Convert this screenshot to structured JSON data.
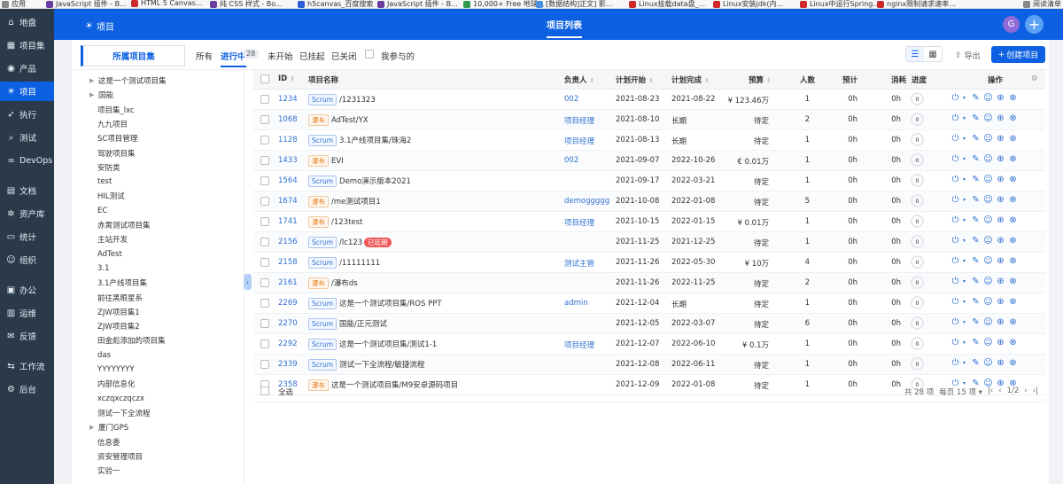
{
  "bookmarks": [
    {
      "label": "应用",
      "color": "#888888"
    },
    {
      "label": "JavaScript 插件 - B...",
      "color": "#6a3ea1"
    },
    {
      "label": "HTML 5 Canvas...",
      "color": "#cc2a2a"
    },
    {
      "label": "纯 CSS 样式 - Bo...",
      "color": "#6a3ea1"
    },
    {
      "label": "h5canvas_百度搜索",
      "color": "#2c5fd6"
    },
    {
      "label": "JavaScript 插件 - B...",
      "color": "#6a3ea1"
    },
    {
      "label": "10,000+ Free 地球...",
      "color": "#2e9b4c"
    },
    {
      "label": "[数据结构]正文] 影...",
      "color": "#4a90e2"
    },
    {
      "label": "Linux挂载data盘_...",
      "color": "#cc2a2a"
    },
    {
      "label": "Linux安装jdk(内...",
      "color": "#cc2a2a"
    },
    {
      "label": "Linux中运行Spring...",
      "color": "#cc2a2a"
    },
    {
      "label": "nginx限制请求速率...",
      "color": "#cc2a2a"
    },
    {
      "label": "阅读清单",
      "color": "#888888"
    }
  ],
  "sidebar": {
    "items": [
      {
        "label": "地盘",
        "icon": "home-icon",
        "glyph": "⌂",
        "active": false
      },
      {
        "label": "项目集",
        "icon": "grid-icon",
        "glyph": "▦",
        "active": false
      },
      {
        "label": "产品",
        "icon": "location-icon",
        "glyph": "◉",
        "active": false
      },
      {
        "label": "项目",
        "icon": "bulb-icon",
        "glyph": "☀",
        "active": true
      },
      {
        "label": "执行",
        "icon": "run-icon",
        "glyph": "➶",
        "active": false
      },
      {
        "label": "测试",
        "icon": "search-icon",
        "glyph": "⌕",
        "active": false
      },
      {
        "label": "DevOps",
        "icon": "infinity-icon",
        "glyph": "∞",
        "active": false
      },
      {
        "label": "文档",
        "icon": "document-icon",
        "glyph": "▤",
        "active": false
      },
      {
        "label": "资产库",
        "icon": "gear-icon",
        "glyph": "✲",
        "active": false
      },
      {
        "label": "统计",
        "icon": "monitor-icon",
        "glyph": "▭",
        "active": false
      },
      {
        "label": "组织",
        "icon": "people-icon",
        "glyph": "☺",
        "active": false
      },
      {
        "label": "办公",
        "icon": "briefcase-icon",
        "glyph": "▣",
        "active": false
      },
      {
        "label": "运维",
        "icon": "server-icon",
        "glyph": "▥",
        "active": false
      },
      {
        "label": "反馈",
        "icon": "feedback-icon",
        "glyph": "✉",
        "active": false
      },
      {
        "label": "工作流",
        "icon": "workflow-icon",
        "glyph": "⇆",
        "active": false
      },
      {
        "label": "后台",
        "icon": "settings-icon",
        "glyph": "⚙",
        "active": false
      }
    ]
  },
  "header": {
    "breadcrumb": "项目",
    "breadcrumb_icon": "☀",
    "center_title": "项目列表",
    "avatar_letter": "G",
    "plus": "+"
  },
  "toolbar": {
    "project_set_tab": "所属项目集",
    "filters": [
      "所有",
      "进行中",
      "未开始",
      "已挂起",
      "已关闭"
    ],
    "active_filter_count": "28",
    "mine_label": "我参与的",
    "export_label": "导出",
    "create_label": "创建项目",
    "list_view_glyph": "☰",
    "card_view_glyph": "▦"
  },
  "tree": {
    "items": [
      {
        "label": "这是一个测试项目集",
        "caret": true
      },
      {
        "label": "国能",
        "caret": true
      },
      {
        "label": "项目集_lxc",
        "caret": false
      },
      {
        "label": "九九项目",
        "caret": false
      },
      {
        "label": "SC项目管理",
        "caret": false
      },
      {
        "label": "驾驶项目集",
        "caret": false
      },
      {
        "label": "安防类",
        "caret": false
      },
      {
        "label": "test",
        "caret": false
      },
      {
        "label": "HIL测试",
        "caret": false
      },
      {
        "label": "EC",
        "caret": false
      },
      {
        "label": "赤霄测试项目集",
        "caret": false
      },
      {
        "label": "主站开发",
        "caret": false
      },
      {
        "label": "AdTest",
        "caret": false
      },
      {
        "label": "3.1",
        "caret": false
      },
      {
        "label": "3.1产线项目集",
        "caret": false
      },
      {
        "label": "前往黑眼星系",
        "caret": false
      },
      {
        "label": "ZJW项目集1",
        "caret": false
      },
      {
        "label": "ZJW项目集2",
        "caret": false
      },
      {
        "label": "田金彪添加的项目集",
        "caret": false
      },
      {
        "label": "das",
        "caret": false
      },
      {
        "label": "YYYYYYYY",
        "caret": false
      },
      {
        "label": "内部信息化",
        "caret": false
      },
      {
        "label": "xczqxczqczx",
        "caret": false
      },
      {
        "label": "测试一下全流程",
        "caret": false
      },
      {
        "label": "厦门GPS",
        "caret": true
      },
      {
        "label": "信息委",
        "caret": false
      },
      {
        "label": "资安管理项目",
        "caret": false
      },
      {
        "label": "实验一",
        "caret": false
      }
    ]
  },
  "table": {
    "headers": {
      "id": "ID",
      "name": "项目名称",
      "owner": "负责人",
      "plan_start": "计划开始",
      "plan_end": "计划完成",
      "budget": "预算",
      "people": "人数",
      "estimate": "预计",
      "consumed": "消耗",
      "progress": "进度",
      "actions": "操作"
    },
    "rows": [
      {
        "id": "1234",
        "tag": "Scrum",
        "type": "scrum",
        "name": "/1231323",
        "delay": "",
        "owner": "002",
        "start": "2021-08-23",
        "end": "2021-08-22",
        "budget": "¥ 123.46万",
        "people": "1",
        "est": "0h",
        "cons": "0h",
        "progress": "0"
      },
      {
        "id": "1068",
        "tag": "瀑布",
        "type": "waterfall",
        "name": "AdTest/YX",
        "delay": "",
        "owner": "项目经理",
        "start": "2021-08-10",
        "end": "长期",
        "budget": "待定",
        "people": "2",
        "est": "0h",
        "cons": "0h",
        "progress": "0"
      },
      {
        "id": "1128",
        "tag": "Scrum",
        "type": "scrum",
        "name": "3.1产线项目集/珠海2",
        "delay": "",
        "owner": "项目经理",
        "start": "2021-08-13",
        "end": "长期",
        "budget": "待定",
        "people": "1",
        "est": "0h",
        "cons": "0h",
        "progress": "0"
      },
      {
        "id": "1433",
        "tag": "瀑布",
        "type": "waterfall",
        "name": "EVI",
        "delay": "",
        "owner": "002",
        "start": "2021-09-07",
        "end": "2022-10-26",
        "budget": "€ 0.01万",
        "people": "1",
        "est": "0h",
        "cons": "0h",
        "progress": "0"
      },
      {
        "id": "1564",
        "tag": "Scrum",
        "type": "scrum",
        "name": "Demo演示版本2021",
        "delay": "",
        "owner": "",
        "start": "2021-09-17",
        "end": "2022-03-21",
        "budget": "待定",
        "people": "1",
        "est": "0h",
        "cons": "0h",
        "progress": "0"
      },
      {
        "id": "1674",
        "tag": "瀑布",
        "type": "waterfall",
        "name": "/me测试项目1",
        "delay": "",
        "owner": "demoggggg",
        "start": "2021-10-08",
        "end": "2022-01-08",
        "budget": "待定",
        "people": "5",
        "est": "0h",
        "cons": "0h",
        "progress": "0"
      },
      {
        "id": "1741",
        "tag": "瀑布",
        "type": "waterfall",
        "name": "/123test",
        "delay": "",
        "owner": "项目经理",
        "start": "2021-10-15",
        "end": "2022-01-15",
        "budget": "¥ 0.01万",
        "people": "1",
        "est": "0h",
        "cons": "0h",
        "progress": "0"
      },
      {
        "id": "2156",
        "tag": "Scrum",
        "type": "scrum",
        "name": "/lc123",
        "delay": "已延期",
        "owner": "",
        "start": "2021-11-25",
        "end": "2021-12-25",
        "budget": "待定",
        "people": "1",
        "est": "0h",
        "cons": "0h",
        "progress": "0"
      },
      {
        "id": "2158",
        "tag": "Scrum",
        "type": "scrum",
        "name": "/11111111",
        "delay": "",
        "owner": "测试主管",
        "start": "2021-11-26",
        "end": "2022-05-30",
        "budget": "¥ 10万",
        "people": "4",
        "est": "0h",
        "cons": "0h",
        "progress": "0"
      },
      {
        "id": "2161",
        "tag": "瀑布",
        "type": "waterfall",
        "name": "/瀑布ds",
        "delay": "",
        "owner": "",
        "start": "2021-11-26",
        "end": "2022-11-25",
        "budget": "待定",
        "people": "2",
        "est": "0h",
        "cons": "0h",
        "progress": "0"
      },
      {
        "id": "2269",
        "tag": "Scrum",
        "type": "scrum",
        "name": "这是一个测试项目集/ROS PPT",
        "delay": "",
        "owner": "admin",
        "start": "2021-12-04",
        "end": "长期",
        "budget": "待定",
        "people": "1",
        "est": "0h",
        "cons": "0h",
        "progress": "0"
      },
      {
        "id": "2270",
        "tag": "Scrum",
        "type": "scrum",
        "name": "国能/正元测试",
        "delay": "",
        "owner": "",
        "start": "2021-12-05",
        "end": "2022-03-07",
        "budget": "待定",
        "people": "6",
        "est": "0h",
        "cons": "0h",
        "progress": "0"
      },
      {
        "id": "2292",
        "tag": "Scrum",
        "type": "scrum",
        "name": "这是一个测试项目集/测试1-1",
        "delay": "",
        "owner": "项目经理",
        "start": "2021-12-07",
        "end": "2022-06-10",
        "budget": "¥ 0.1万",
        "people": "1",
        "est": "0h",
        "cons": "0h",
        "progress": "0"
      },
      {
        "id": "2339",
        "tag": "Scrum",
        "type": "scrum",
        "name": "测试一下全流程/敏捷流程",
        "delay": "",
        "owner": "",
        "start": "2021-12-08",
        "end": "2022-06-11",
        "budget": "待定",
        "people": "1",
        "est": "0h",
        "cons": "0h",
        "progress": "0"
      },
      {
        "id": "2358",
        "tag": "瀑布",
        "type": "waterfall",
        "name": "这是一个测试项目集/M9安卓源码项目",
        "delay": "",
        "owner": "",
        "start": "2021-12-09",
        "end": "2022-01-08",
        "budget": "待定",
        "people": "1",
        "est": "0h",
        "cons": "0h",
        "progress": "0"
      }
    ],
    "select_all": "全选",
    "pager": {
      "total": "共 28 项",
      "per_page": "每页 15 项",
      "page": "1/2"
    }
  },
  "colors": {
    "primary": "#0c60e1",
    "sidebar": "#2b3a4a",
    "scrum": "#2d6fd2",
    "waterfall": "#e67a17",
    "delay": "#f05656"
  }
}
